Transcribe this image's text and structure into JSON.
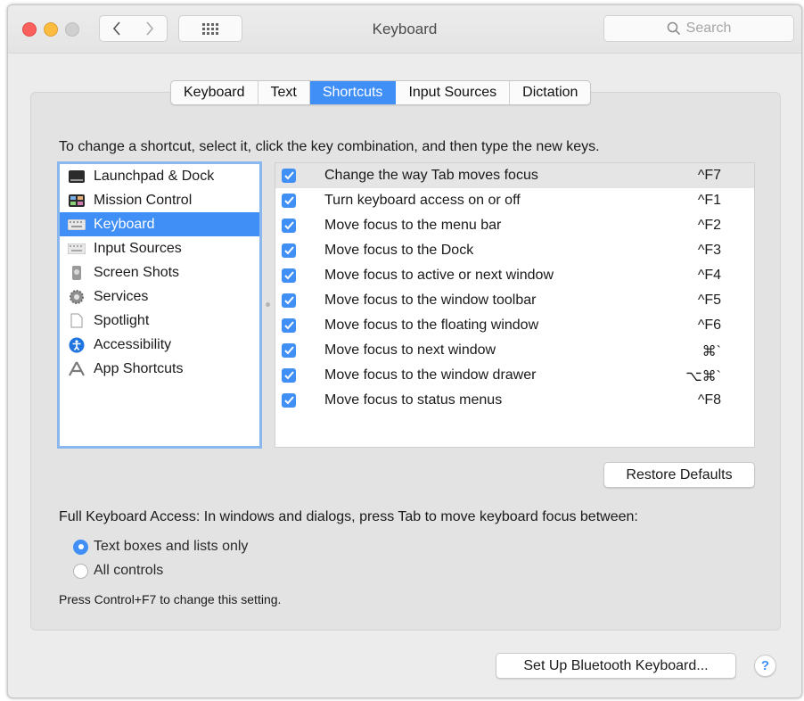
{
  "window": {
    "title": "Keyboard"
  },
  "search": {
    "placeholder": "Search"
  },
  "tabs": [
    {
      "label": "Keyboard",
      "active": false
    },
    {
      "label": "Text",
      "active": false
    },
    {
      "label": "Shortcuts",
      "active": true
    },
    {
      "label": "Input Sources",
      "active": false
    },
    {
      "label": "Dictation",
      "active": false
    }
  ],
  "instructions": "To change a shortcut, select it, click the key combination, and then type the new keys.",
  "categories": [
    {
      "label": "Launchpad & Dock",
      "icon": "launchpad-dock-icon"
    },
    {
      "label": "Mission Control",
      "icon": "mission-control-icon"
    },
    {
      "label": "Keyboard",
      "icon": "keyboard-icon",
      "selected": true
    },
    {
      "label": "Input Sources",
      "icon": "input-sources-icon"
    },
    {
      "label": "Screen Shots",
      "icon": "screenshot-icon"
    },
    {
      "label": "Services",
      "icon": "gear-icon"
    },
    {
      "label": "Spotlight",
      "icon": "document-icon"
    },
    {
      "label": "Accessibility",
      "icon": "accessibility-icon"
    },
    {
      "label": "App Shortcuts",
      "icon": "app-shortcuts-icon"
    }
  ],
  "shortcuts": [
    {
      "label": "Change the way Tab moves focus",
      "key": "^F7",
      "checked": true
    },
    {
      "label": "Turn keyboard access on or off",
      "key": "^F1",
      "checked": true
    },
    {
      "label": "Move focus to the menu bar",
      "key": "^F2",
      "checked": true
    },
    {
      "label": "Move focus to the Dock",
      "key": "^F3",
      "checked": true
    },
    {
      "label": "Move focus to active or next window",
      "key": "^F4",
      "checked": true
    },
    {
      "label": "Move focus to the window toolbar",
      "key": "^F5",
      "checked": true
    },
    {
      "label": "Move focus to the floating window",
      "key": "^F6",
      "checked": true
    },
    {
      "label": "Move focus to next window",
      "key": "⌘`",
      "checked": true
    },
    {
      "label": "Move focus to the window drawer",
      "key": "⌥⌘`",
      "checked": true
    },
    {
      "label": "Move focus to status menus",
      "key": "^F8",
      "checked": true
    }
  ],
  "restore_defaults": "Restore Defaults",
  "full_keyboard_access": {
    "label": "Full Keyboard Access: In windows and dialogs, press Tab to move keyboard focus between:",
    "options": [
      {
        "label": "Text boxes and lists only",
        "selected": true
      },
      {
        "label": "All controls",
        "selected": false
      }
    ],
    "note": "Press Control+F7 to change this setting."
  },
  "bluetooth_button": "Set Up Bluetooth Keyboard...",
  "help_button": "?",
  "colors": {
    "accent": "#3f8ff7",
    "window_bg": "#ececec",
    "panel_bg": "#e3e3e3"
  }
}
